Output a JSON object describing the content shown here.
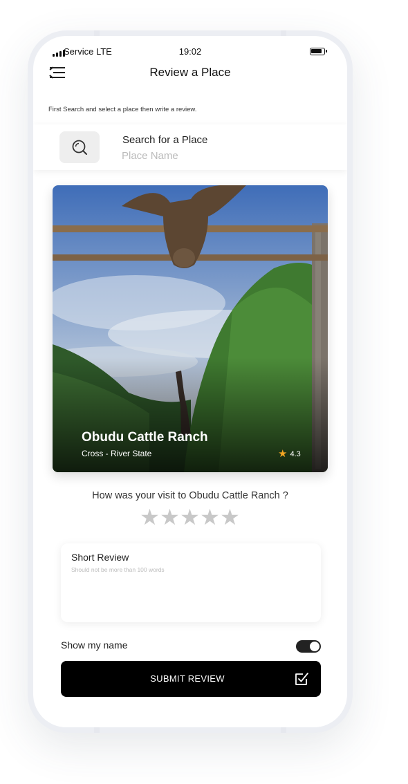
{
  "status_bar": {
    "carrier": "Service  LTE",
    "time": "19:02"
  },
  "header": {
    "title": "Review a Place",
    "menu_icon": "menu-icon"
  },
  "instruction": "First Search and select a place then write a review.",
  "search": {
    "title": "Search for a Place",
    "placeholder": "Place Name",
    "icon": "search-icon"
  },
  "place": {
    "name": "Obudu Cattle Ranch",
    "location": "Cross - River State",
    "rating": "4.3",
    "rating_icon": "star-icon"
  },
  "review": {
    "prompt": "How was your visit to  Obudu Cattle Ranch ?",
    "stars_selected": 0,
    "stars_total": 5,
    "label": "Short Review",
    "hint": "Should not be more than 100 words"
  },
  "show_name": {
    "label": "Show my name",
    "enabled": true
  },
  "submit": {
    "label": "SUBMIT REVIEW",
    "icon": "check-square-icon"
  },
  "colors": {
    "accent": "#000000",
    "star_active": "#f5a623",
    "star_inactive": "#c8c8c8",
    "search_button_bg": "#eeeeee"
  }
}
